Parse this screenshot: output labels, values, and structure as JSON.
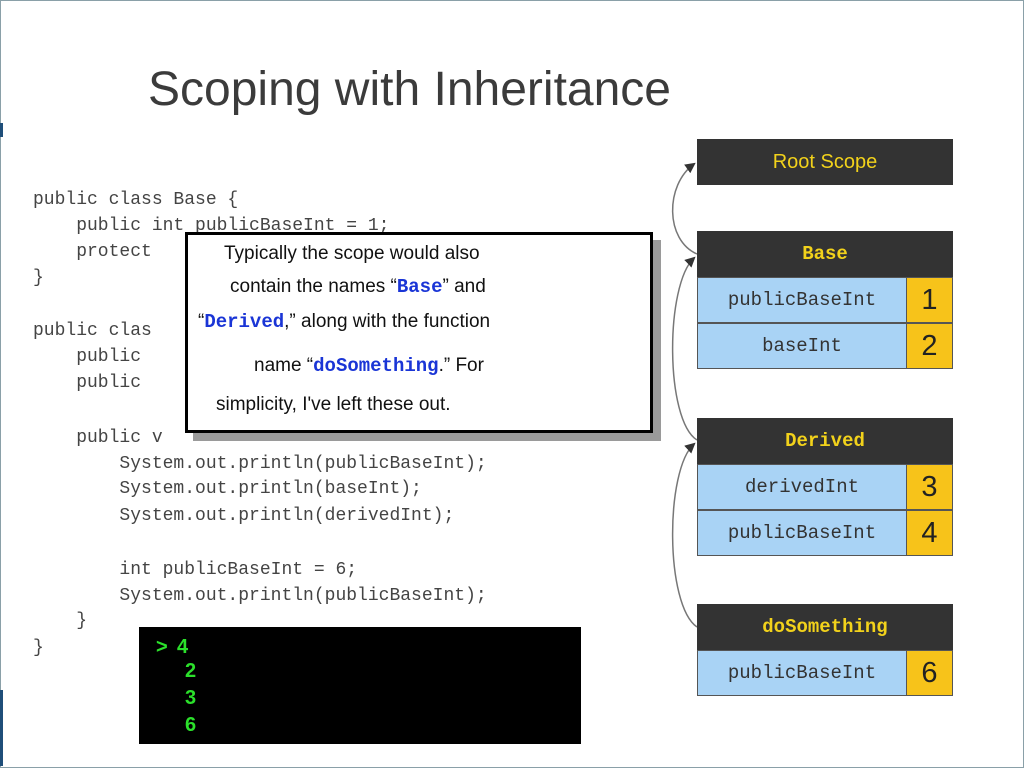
{
  "slide": {
    "title": "Scoping with Inheritance"
  },
  "code": {
    "lines": [
      "public class Base {",
      "    public int publicBaseInt = 1;",
      "    protect",
      "}",
      "",
      "public clas",
      "    public",
      "    public",
      "",
      "    public v",
      "        System.out.println(publicBaseInt);",
      "        System.out.println(baseInt);",
      "        System.out.println(derivedInt);",
      "",
      "        int publicBaseInt = 6;",
      "        System.out.println(publicBaseInt);",
      "    }",
      "}"
    ]
  },
  "popup": {
    "line1": "Typically the scope would also",
    "line2_pre": "contain the names “",
    "line2_kw": "Base",
    "line2_post": "” and",
    "line3_pre": "“",
    "line3_kw": "Derived",
    "line3_post": ",” along with the function",
    "line4_pre": "name “",
    "line4_kw": "doSomething",
    "line4_post": ".”  For",
    "line5": "simplicity, I've left these out."
  },
  "console": {
    "prompt": ">",
    "outputs": [
      "4",
      "2",
      "3",
      "6"
    ]
  },
  "scopes": {
    "root": {
      "label": "Root Scope"
    },
    "base": {
      "label": "Base",
      "rows": [
        {
          "name": "publicBaseInt",
          "value": "1"
        },
        {
          "name": "baseInt",
          "value": "2"
        }
      ]
    },
    "derived": {
      "label": "Derived",
      "rows": [
        {
          "name": "derivedInt",
          "value": "3"
        },
        {
          "name": "publicBaseInt",
          "value": "4"
        }
      ]
    },
    "dosomething": {
      "label": "doSomething",
      "rows": [
        {
          "name": "publicBaseInt",
          "value": "6"
        }
      ]
    }
  }
}
